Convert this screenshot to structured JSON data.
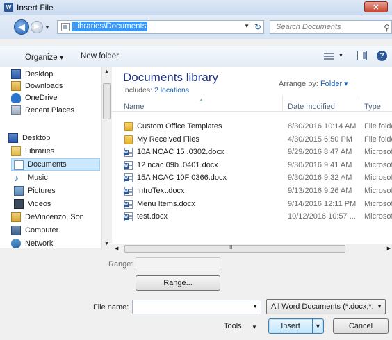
{
  "window": {
    "title": "Insert File",
    "app_icon": "W",
    "close_glyph": "✕"
  },
  "address": {
    "back_glyph": "◀",
    "forward_glyph": "▶",
    "history_glyph": "▼",
    "path": "Libraries\\Documents",
    "drop_glyph": "▼",
    "refresh_glyph": "↻"
  },
  "search": {
    "placeholder": "Search Documents",
    "icon_glyph": "⚲"
  },
  "toolbar": {
    "organize_label": "Organize ▾",
    "new_folder_label": "New folder",
    "views_drop_glyph": "▼",
    "help_glyph": "?"
  },
  "nav": {
    "items": [
      {
        "label": "Desktop",
        "icon": "desktop-icon"
      },
      {
        "label": "Downloads",
        "icon": "downloads-icon"
      },
      {
        "label": "OneDrive",
        "icon": "onedrive-icon"
      },
      {
        "label": "Recent Places",
        "icon": "recent-places-icon"
      },
      {
        "label": "Desktop",
        "icon": "desktop-icon"
      },
      {
        "label": "Libraries",
        "icon": "libraries-icon"
      },
      {
        "label": "Documents",
        "icon": "documents-icon",
        "selected": true
      },
      {
        "label": "Music",
        "icon": "music-icon"
      },
      {
        "label": "Pictures",
        "icon": "pictures-icon"
      },
      {
        "label": "Videos",
        "icon": "videos-icon"
      },
      {
        "label": "DeVincenzo, Son",
        "icon": "user-folder-icon"
      },
      {
        "label": "Computer",
        "icon": "computer-icon"
      },
      {
        "label": "Network",
        "icon": "network-icon"
      }
    ],
    "scroll_up": "▲",
    "scroll_down": "▼"
  },
  "library": {
    "title": "Documents library",
    "includes_prefix": "Includes:",
    "includes_link": "2 locations",
    "arrange_label": "Arrange by:",
    "arrange_value": "Folder ▾"
  },
  "columns": {
    "name": "Name",
    "date": "Date modified",
    "type": "Type",
    "sort_glyph": "▲"
  },
  "files": [
    {
      "name": "Custom Office Templates",
      "date": "8/30/2016 10:14 AM",
      "type": "File folder",
      "kind": "folder"
    },
    {
      "name": "My Received Files",
      "date": "4/30/2015 6:50 PM",
      "type": "File folder",
      "kind": "folder"
    },
    {
      "name": "10A NCAC 15 .0302.docx",
      "date": "9/29/2016 8:47 AM",
      "type": "Microsoft",
      "kind": "doc"
    },
    {
      "name": "12 ncac 09b .0401.docx",
      "date": "9/30/2016 9:41 AM",
      "type": "Microsoft",
      "kind": "doc"
    },
    {
      "name": "15A NCAC 10F  0366.docx",
      "date": "9/30/2016 9:32 AM",
      "type": "Microsoft",
      "kind": "doc"
    },
    {
      "name": "IntroText.docx",
      "date": "9/13/2016 9:26 AM",
      "type": "Microsoft",
      "kind": "doc"
    },
    {
      "name": "Menu Items.docx",
      "date": "9/14/2016 12:11 PM",
      "type": "Microsoft",
      "kind": "doc"
    },
    {
      "name": "test.docx",
      "date": "10/12/2016 10:57 ...",
      "type": "Microsoft",
      "kind": "doc"
    }
  ],
  "hscroll": {
    "left": "◀",
    "grip": "III",
    "right": "▶"
  },
  "range": {
    "label": "Range:",
    "button": "Range..."
  },
  "filename": {
    "label": "File name:",
    "value": "",
    "drop_glyph": "▼"
  },
  "filetype": {
    "value": "All Word Documents (*.docx;*.d",
    "drop_glyph": "▼"
  },
  "actions": {
    "tools_label": "Tools",
    "tools_drop": "▼",
    "insert_label": "Insert",
    "insert_drop": "▼",
    "cancel_label": "Cancel"
  },
  "colors": {
    "selection": "#cce8ff",
    "link": "#1a62b4",
    "library_title": "#1e3287"
  }
}
